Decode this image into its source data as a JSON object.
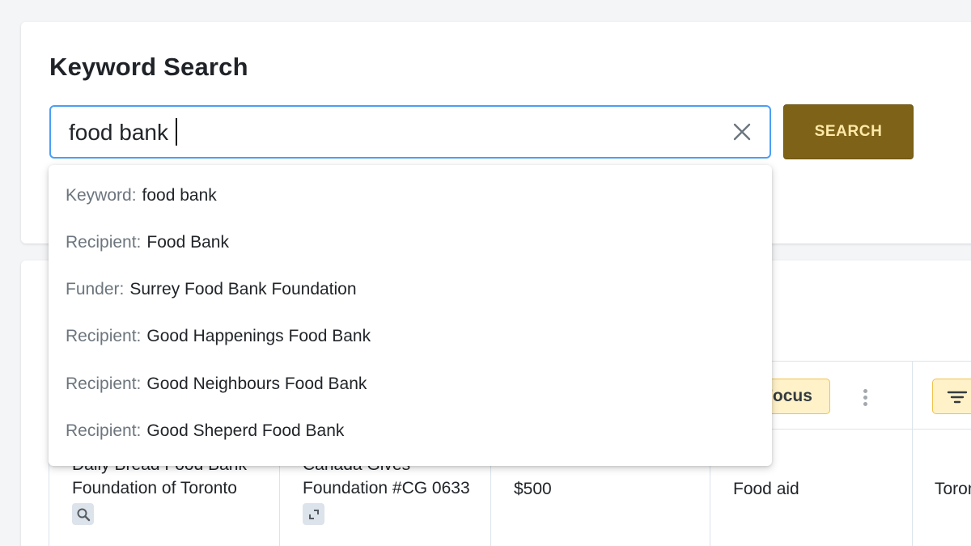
{
  "search": {
    "title": "Keyword Search",
    "query": "food bank",
    "button_label": "SEARCH"
  },
  "suggestions": [
    {
      "type": "Keyword:",
      "value": "food bank"
    },
    {
      "type": "Recipient:",
      "value": "Food Bank"
    },
    {
      "type": "Funder:",
      "value": "Surrey Food Bank Foundation"
    },
    {
      "type": "Recipient:",
      "value": "Good Happenings Food Bank"
    },
    {
      "type": "Recipient:",
      "value": "Good Neighbours Food Bank"
    },
    {
      "type": "Recipient:",
      "value": "Good Sheperd Food Bank"
    }
  ],
  "table": {
    "header_focus_label": "Focus",
    "row": {
      "recipient_line1": "Daily Bread Food Bank",
      "recipient_line2": "Foundation of Toronto",
      "funder_line1": "Canada Gives",
      "funder_line2": "Foundation #CG 0633",
      "amount": "$500",
      "focus": "Food aid",
      "city": "Toronto"
    }
  },
  "colors": {
    "accent_button": "#7d6217",
    "input_border": "#4a9ff5",
    "chip_bg": "#fff2c8",
    "chip_border": "#f0c24e"
  }
}
